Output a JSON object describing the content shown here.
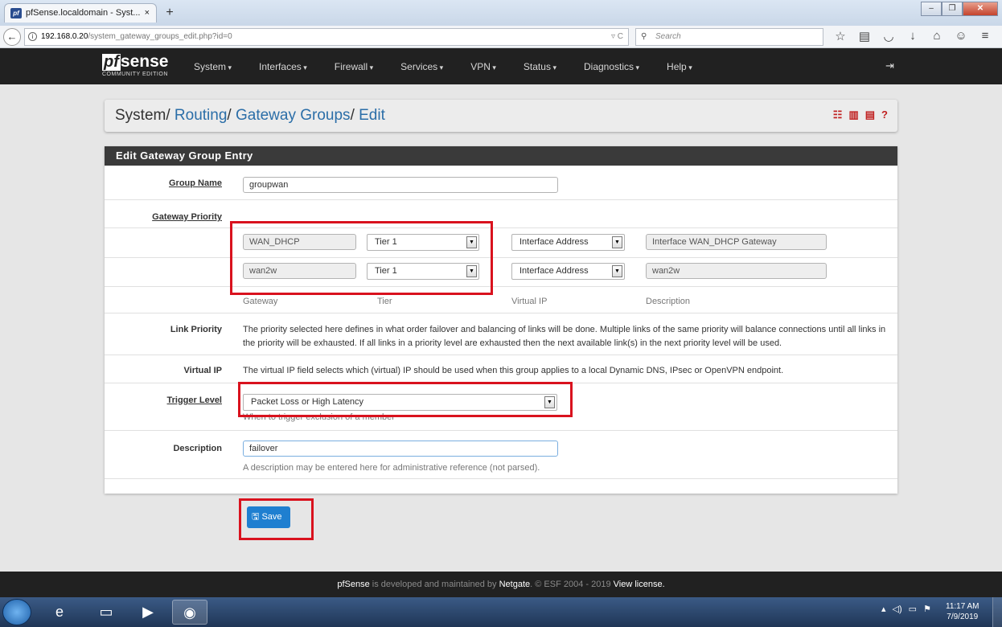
{
  "browser": {
    "tab_title": "pfSense.localdomain - Syst...",
    "tab_close": "×",
    "new_tab": "+",
    "url_host": "192.168.0.20",
    "url_path": "/system_gateway_groups_edit.php?id=0",
    "search_placeholder": "Search",
    "window_buttons": [
      "–",
      "❐",
      "✕"
    ],
    "toolbar_icons": [
      "star-icon",
      "reading-list-icon",
      "pocket-icon",
      "download-icon",
      "home-icon",
      "chat-icon",
      "menu-icon"
    ]
  },
  "header": {
    "logo_pf": "pf",
    "logo_sense": "sense",
    "logo_edition": "COMMUNITY EDITION",
    "menu": [
      "System",
      "Interfaces",
      "Firewall",
      "Services",
      "VPN",
      "Status",
      "Diagnostics",
      "Help"
    ]
  },
  "breadcrumb": {
    "root": "System",
    "sep": "/",
    "level1": "Routing",
    "level2": "Gateway Groups",
    "level3": "Edit"
  },
  "panel": {
    "title": "Edit Gateway Group Entry",
    "group_name_label": "Group Name",
    "group_name_value": "groupwan",
    "gateway_priority_label": "Gateway Priority",
    "gateways": [
      {
        "gateway": "WAN_DHCP",
        "tier": "Tier 1",
        "vip": "Interface Address",
        "description": "Interface WAN_DHCP Gateway"
      },
      {
        "gateway": "wan2w",
        "tier": "Tier 1",
        "vip": "Interface Address",
        "description": "wan2w"
      }
    ],
    "col_headers": {
      "gateway": "Gateway",
      "tier": "Tier",
      "vip": "Virtual IP",
      "description": "Description"
    },
    "link_priority_label": "Link Priority",
    "link_priority_text": "The priority selected here defines in what order failover and balancing of links will be done. Multiple links of the same priority will balance connections until all links in the priority will be exhausted. If all links in a priority level are exhausted then the next available link(s) in the next priority level will be used.",
    "virtual_ip_label": "Virtual IP",
    "virtual_ip_text": "The virtual IP field selects which (virtual) IP should be used when this group applies to a local Dynamic DNS, IPsec or OpenVPN endpoint.",
    "trigger_level_label": "Trigger Level",
    "trigger_level_value": "Packet Loss or High Latency",
    "trigger_level_hint": "When to trigger exclusion of a member",
    "description_label": "Description",
    "description_value": "failover",
    "description_hint": "A description may be entered here for administrative reference (not parsed).",
    "save_label": "Save"
  },
  "footer": {
    "brand": "pfSense",
    "text1": " is developed and maintained by ",
    "company": "Netgate",
    "text2": ". © ESF 2004 - 2019 ",
    "license": "View license."
  },
  "taskbar": {
    "time": "11:17 AM",
    "date": "7/9/2019"
  },
  "colors": {
    "highlight": "#d9121e",
    "link": "#2b6ea8",
    "save_button": "#1f7fd0",
    "header_bg": "#212121"
  }
}
